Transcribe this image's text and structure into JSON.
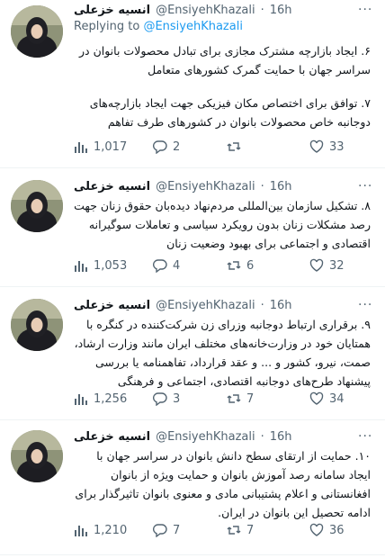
{
  "tweets": [
    {
      "name": "انسیه خزعلی",
      "handle": "@EnsiyehKhazali",
      "dot": "·",
      "time": "16h",
      "reply_prefix": "Replying to",
      "reply_mention": "@EnsiyehKhazali",
      "paragraphs": [
        "۶. ایجاد بازارچه مشترک مجازی برای تبادل محصولات بانوان در سراسر جهان با حمایت گمرک کشورهای متعامل",
        "۷. توافق برای اختصاص مکان فیزیکی جهت ایجاد بازارچه‌های دوجانبه خاص محصولات بانوان در کشورهای طرف تفاهم"
      ],
      "views": "1,017",
      "replies": "2",
      "retweets": "",
      "likes": "33"
    },
    {
      "name": "انسیه خزعلی",
      "handle": "@EnsiyehKhazali",
      "dot": "·",
      "time": "16h",
      "paragraphs": [
        "۸. تشکیل سازمان بین‌المللی مردم‌نهاد دیده‌بان حقوق زنان جهت رصد مشکلات زنان بدون رویکرد سیاسی و تعاملات سوگیرانه اقتصادی و اجتماعی برای بهبود وضعیت زنان"
      ],
      "views": "1,053",
      "replies": "4",
      "retweets": "6",
      "likes": "32"
    },
    {
      "name": "انسیه خزعلی",
      "handle": "@EnsiyehKhazali",
      "dot": "·",
      "time": "16h",
      "paragraphs": [
        "۹. برقراری ارتباط دوجانبه وزرای زن شرکت‌کننده در کنگره با همتایان خود در وزارت‌خانه‌های مختلف ایران مانند وزارت ارشاد، صمت، نیرو، کشور و ... و عقد قرارداد، تفاهمنامه یا بررسی پیشنهاد طرح‌های دوجانبه اقتصادی، اجتماعی و فرهنگی"
      ],
      "views": "1,256",
      "replies": "3",
      "retweets": "7",
      "likes": "34"
    },
    {
      "name": "انسیه خزعلی",
      "handle": "@EnsiyehKhazali",
      "dot": "·",
      "time": "16h",
      "paragraphs": [
        "۱۰. حمایت از ارتقای سطح دانش بانوان در سراسر جهان با ایجاد سامانه رصد آموزش بانوان و حمایت ویژه از بانوان افغانستانی و اعلام پشتیبانی مادی و معنوی بانوان تاثیرگذار برای ادامه تحصیل این بانوان در ایران."
      ],
      "views": "1,210",
      "replies": "7",
      "retweets": "7",
      "likes": "36"
    }
  ],
  "colors": {
    "text": "#0f1419",
    "secondary": "#536471",
    "link": "#1d9bf0",
    "divider": "#eff3f4"
  },
  "icons": [
    "views-icon",
    "reply-icon",
    "retweet-icon",
    "like-icon",
    "more-icon"
  ]
}
